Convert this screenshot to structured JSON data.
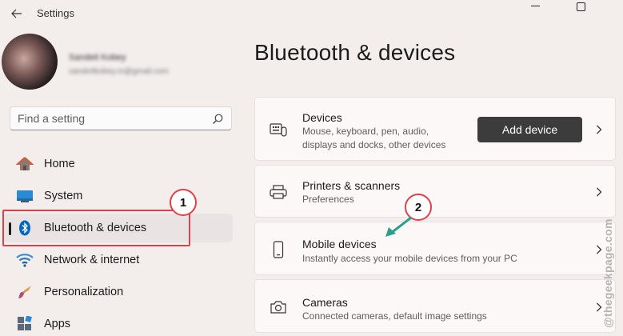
{
  "window": {
    "title": "Settings"
  },
  "profile": {
    "name": "Sandeit Kobey",
    "email": "sandeitkobey.m@gmail.com"
  },
  "search": {
    "placeholder": "Find a setting"
  },
  "nav": {
    "items": [
      {
        "label": "Home",
        "icon": "home-icon"
      },
      {
        "label": "System",
        "icon": "monitor-icon"
      },
      {
        "label": "Bluetooth & devices",
        "icon": "bluetooth-icon",
        "selected": true
      },
      {
        "label": "Network & internet",
        "icon": "wifi-icon"
      },
      {
        "label": "Personalization",
        "icon": "brush-icon"
      },
      {
        "label": "Apps",
        "icon": "apps-icon"
      }
    ]
  },
  "main": {
    "title": "Bluetooth & devices",
    "cards": [
      {
        "title": "Devices",
        "desc": "Mouse, keyboard, pen, audio, displays and docks, other devices",
        "icon": "devices-icon",
        "button": "Add device"
      },
      {
        "title": "Printers & scanners",
        "desc": "Preferences",
        "icon": "printer-icon"
      },
      {
        "title": "Mobile devices",
        "desc": "Instantly access your mobile devices from your PC",
        "icon": "phone-icon"
      },
      {
        "title": "Cameras",
        "desc": "Connected cameras, default image settings",
        "icon": "camera-icon"
      }
    ]
  },
  "annotations": {
    "callout1": "1",
    "callout2": "2",
    "highlight_color": "#e0404a",
    "arrow_color": "#2aa08a"
  },
  "watermark": "@thegeekpage.com",
  "colors": {
    "accent_blue": "#0067c0",
    "background": "#f3eeec"
  }
}
